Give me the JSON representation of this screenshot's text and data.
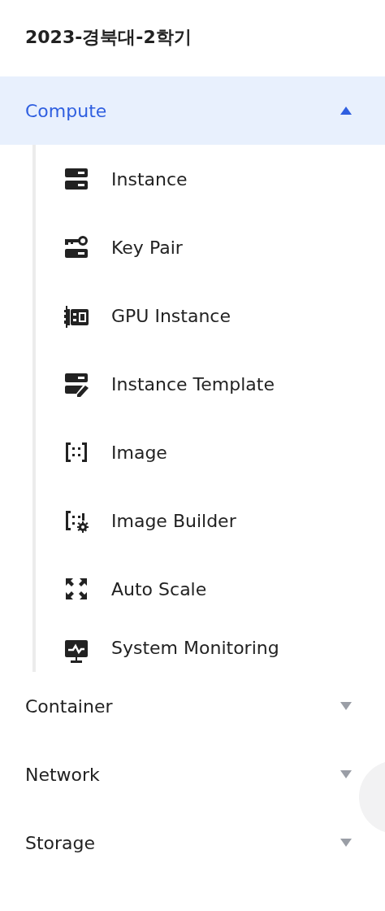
{
  "project_title": "2023-경북대-2학기",
  "sections": [
    {
      "label": "Compute",
      "expanded": true,
      "selected": true,
      "items": [
        {
          "label": "Instance",
          "kind": "server"
        },
        {
          "label": "Key Pair",
          "kind": "key"
        },
        {
          "label": "GPU Instance",
          "kind": "gpu"
        },
        {
          "label": "Instance Template",
          "kind": "template"
        },
        {
          "label": "Image",
          "kind": "image"
        },
        {
          "label": "Image Builder",
          "kind": "builder"
        },
        {
          "label": "Auto Scale",
          "kind": "scale"
        },
        {
          "label": "System Monitoring",
          "kind": "monitor"
        }
      ]
    },
    {
      "label": "Container",
      "expanded": false,
      "selected": false
    },
    {
      "label": "Network",
      "expanded": false,
      "selected": false
    },
    {
      "label": "Storage",
      "expanded": false,
      "selected": false
    }
  ]
}
